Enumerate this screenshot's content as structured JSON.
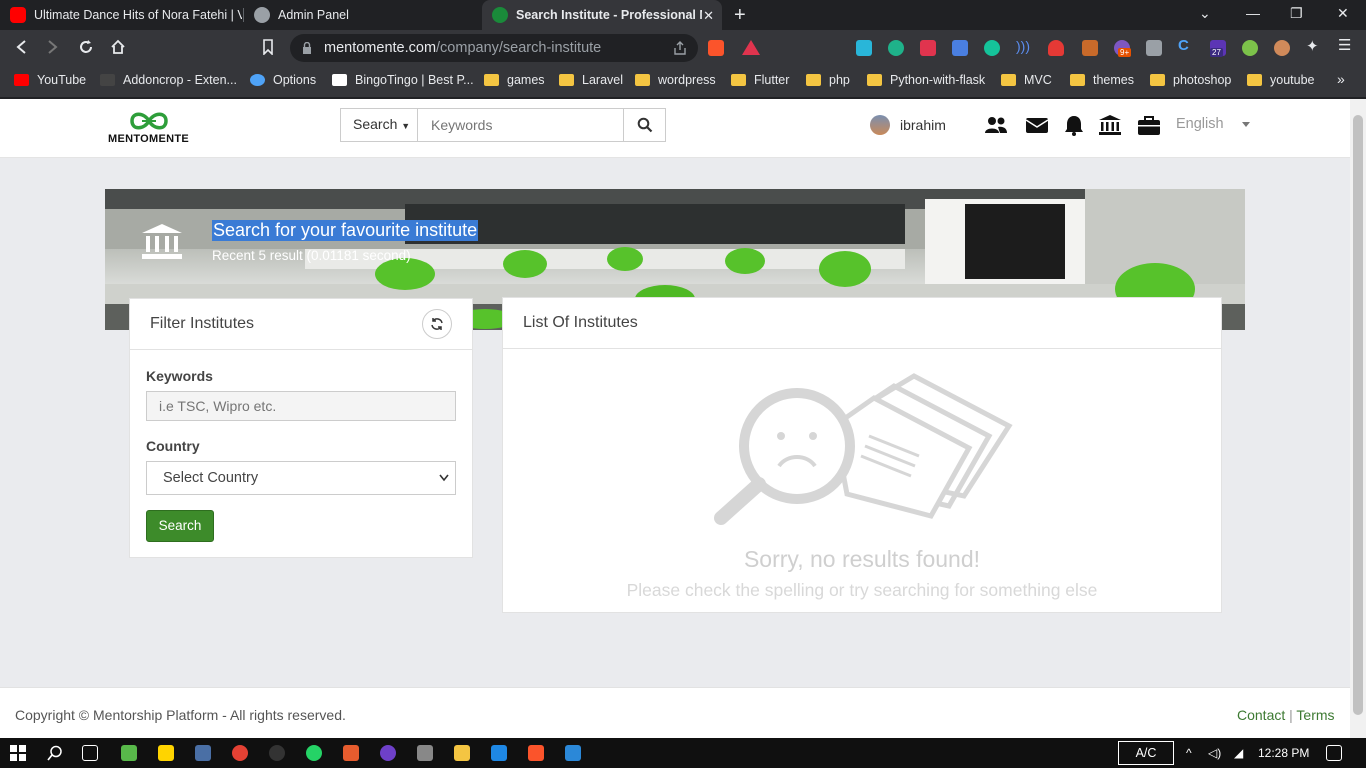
{
  "browser": {
    "tabs": [
      {
        "title": "Ultimate Dance Hits of Nora Fatehi | V",
        "icon": "youtube-icon"
      },
      {
        "title": "Admin Panel",
        "icon": "globe-icon"
      },
      {
        "title": "Search Institute - Professional Ne",
        "icon": "mentomente-icon"
      }
    ],
    "url_domain": "mentomente.com",
    "url_path": "/company/search-institute",
    "bookmarks": [
      "YouTube",
      "Addoncrop - Exten...",
      "Options",
      "BingoTingo | Best P...",
      "games",
      "Laravel",
      "wordpress",
      "Flutter",
      "php",
      "Python-with-flask",
      "MVC",
      "themes",
      "photoshop",
      "youtube"
    ],
    "extension_badges": {
      "extension_9": "9+",
      "extension_27": "27"
    }
  },
  "header": {
    "logo_text": "MENTOMENTE",
    "search_dropdown": "Search",
    "search_placeholder": "Keywords",
    "username": "ibrahim",
    "language": "English"
  },
  "banner": {
    "title": "Search for your favourite institute",
    "subtitle": "Recent 5 result (0.01181 second)"
  },
  "filter": {
    "title": "Filter Institutes",
    "keywords_label": "Keywords",
    "keywords_placeholder": "i.e TSC, Wipro etc.",
    "country_label": "Country",
    "country_selected": "Select Country",
    "search_button": "Search"
  },
  "list": {
    "title": "List Of Institutes",
    "empty_title": "Sorry, no results found!",
    "empty_message": "Please check the spelling or try searching for something else"
  },
  "footer": {
    "copyright": "Copyright © Mentorship Platform - All rights reserved.",
    "contact": "Contact",
    "separator": "|",
    "terms": "Terms"
  },
  "taskbar": {
    "keyboard_indicator": "A/C",
    "time": "12:28 PM"
  },
  "colors": {
    "brand_green": "#3d8b2a",
    "selection_blue": "#3a7bd5",
    "page_background": "#eaebee"
  }
}
